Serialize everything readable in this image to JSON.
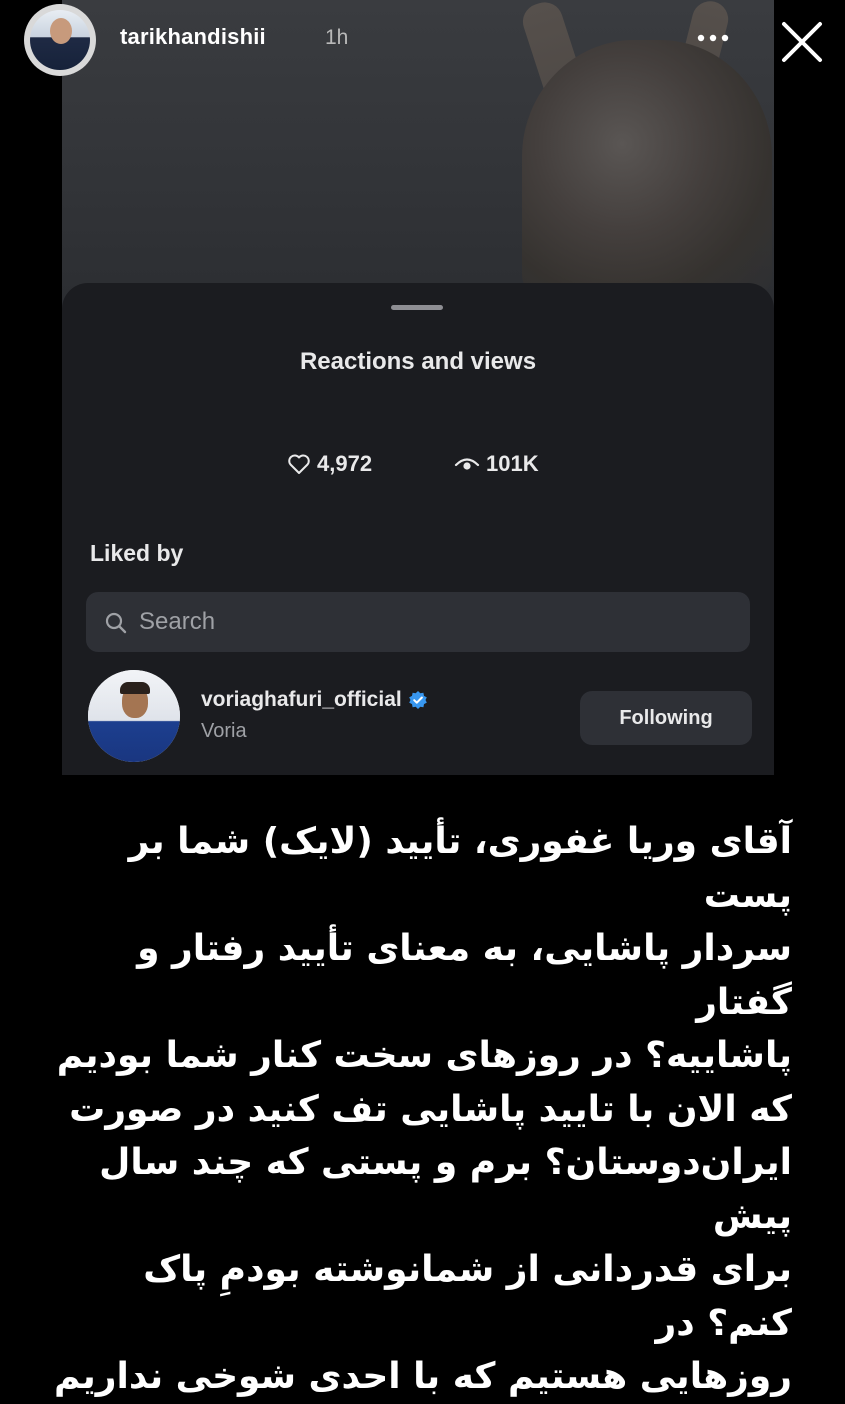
{
  "story": {
    "username": "tarikhandishii",
    "timestamp": "1h"
  },
  "embedded": {
    "sheet_title": "Reactions and views",
    "likes": "4,972",
    "views": "101K",
    "liked_by_label": "Liked by",
    "search_placeholder": "Search",
    "user": {
      "username": "voriaghafuri_official",
      "display_name": "Voria",
      "button_label": "Following"
    }
  },
  "caption": {
    "lines": [
      "آقای وریا غفوری، تأیید (لایک) شما بر پست",
      "سردار پاشایی، به معنای تأیید رفتار و گفتار",
      "پاشاییه؟ در روزهای سخت کنار شما بودیم",
      "که الان با تایید پاشایی تف کنید در صورت",
      "ایران‌دوستان؟ برم و پستی که چند سال پیش",
      "برای قدردانی از شمانوشته بودمِ پاک کنم؟ در",
      "روزهایی هستیم که با احدی شوخی نداریم"
    ]
  },
  "colors": {
    "background": "#000000",
    "sheet": "#1b1c20",
    "field": "#2e3036",
    "verified": "#3897f0"
  }
}
